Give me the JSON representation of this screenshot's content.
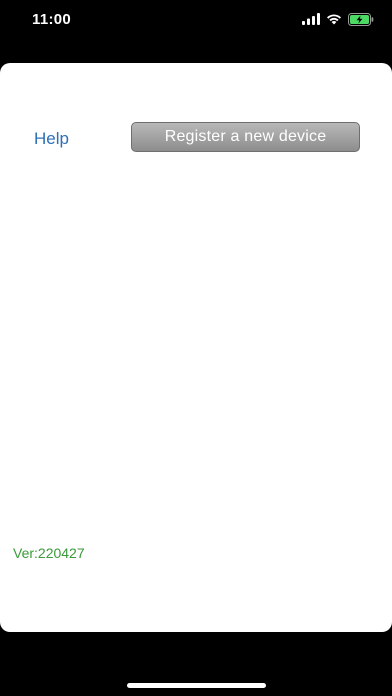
{
  "status_bar": {
    "time": "11:00",
    "icons": [
      "signal-icon",
      "wifi-icon",
      "battery-charging-icon"
    ]
  },
  "sheet": {
    "help_label": "Help",
    "register_button_label": "Register a new device",
    "version_label": "Ver:220427"
  },
  "colors": {
    "background": "#000000",
    "sheet": "#ffffff",
    "help_link": "#2e6fb8",
    "button": "#9a9a9a",
    "version_text": "#3a9a3a",
    "battery_fill": "#4cd964"
  }
}
